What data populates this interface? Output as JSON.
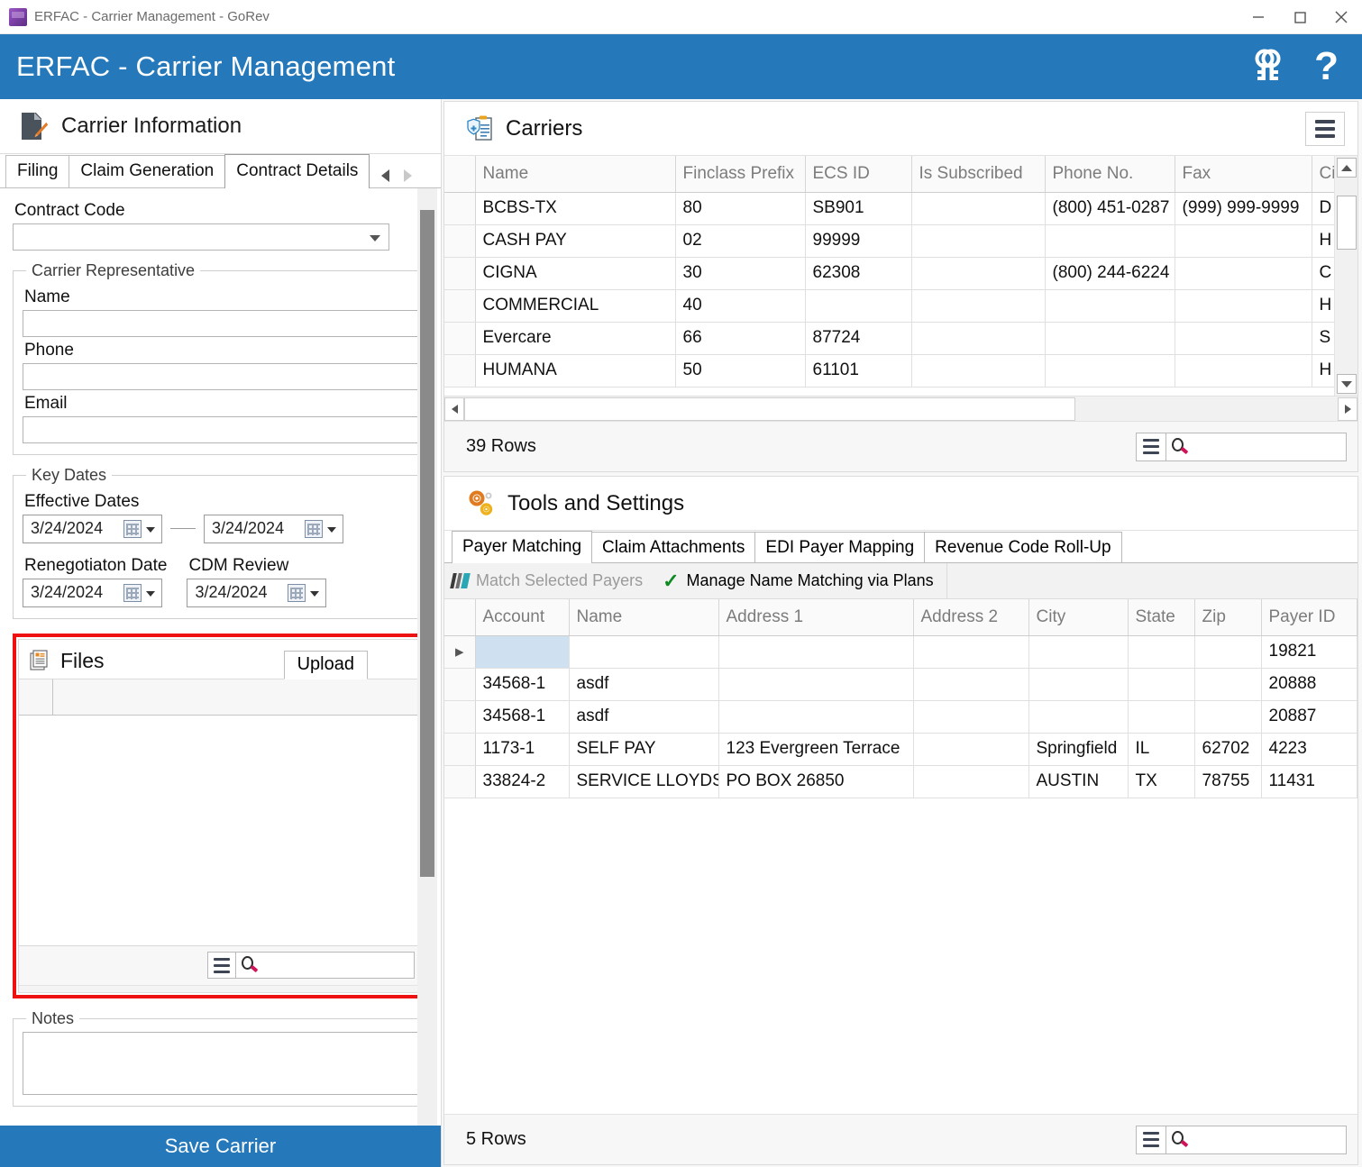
{
  "window": {
    "title": "ERFAC - Carrier Management - GoRev",
    "app_icon": "gorev-cube-icon",
    "minimize": "minimize-icon",
    "maximize": "maximize-icon",
    "close": "close-icon"
  },
  "header": {
    "title": "ERFAC - Carrier Management",
    "keys_icon": "keys-icon",
    "help_label": "?",
    "accent_color": "#2579ba"
  },
  "left_panel": {
    "heading": "Carrier Information",
    "heading_icon": "document-pen-icon",
    "tabs": [
      {
        "label": "Filing",
        "active": false
      },
      {
        "label": "Claim Generation",
        "active": false
      },
      {
        "label": "Contract Details",
        "active": true
      }
    ],
    "tab_nav": {
      "prev": "chevron-left-icon",
      "next": "chevron-right-icon"
    },
    "contract_code": {
      "label": "Contract Code",
      "value": "",
      "placeholder": ""
    },
    "carrier_representative": {
      "legend": "Carrier Representative",
      "fields": [
        {
          "label": "Name",
          "value": ""
        },
        {
          "label": "Phone",
          "value": ""
        },
        {
          "label": "Email",
          "value": ""
        }
      ]
    },
    "key_dates": {
      "legend": "Key Dates",
      "effective_label": "Effective Dates",
      "effective_from": "3/24/2024",
      "effective_to": "3/24/2024",
      "renegotiation_label": "Renegotiaton Date",
      "renegotiation_date": "3/24/2024",
      "cdm_label": "CDM Review",
      "cdm_date": "3/24/2024",
      "calendar_icon": "calendar-icon"
    },
    "files": {
      "title": "Files",
      "title_icon": "files-icon",
      "upload_label": "Upload",
      "highlight_color": "#ee1111",
      "rows": [],
      "hamburger_icon": "hamburger-icon",
      "search_icon": "search-icon",
      "search_value": ""
    },
    "notes": {
      "legend": "Notes",
      "value": ""
    },
    "save_button": "Save Carrier"
  },
  "carriers": {
    "title": "Carriers",
    "title_icon": "shield-clipboard-icon",
    "menu_icon": "hamburger-icon",
    "columns": [
      "Name",
      "Finclass Prefix",
      "ECS ID",
      "Is Subscribed",
      "Phone No.",
      "Fax",
      "City"
    ],
    "rows": [
      {
        "name": "BCBS-TX",
        "finclass_prefix": "80",
        "ecs_id": "SB901",
        "is_subscribed": "",
        "phone": "(800) 451-0287",
        "fax": "(999) 999-9999",
        "city": "D"
      },
      {
        "name": "CASH PAY",
        "finclass_prefix": "02",
        "ecs_id": "99999",
        "is_subscribed": "",
        "phone": "",
        "fax": "",
        "city": "H"
      },
      {
        "name": "CIGNA",
        "finclass_prefix": "30",
        "ecs_id": "62308",
        "is_subscribed": "",
        "phone": "(800) 244-6224",
        "fax": "",
        "city": "C"
      },
      {
        "name": "COMMERCIAL",
        "finclass_prefix": "40",
        "ecs_id": "",
        "is_subscribed": "",
        "phone": "",
        "fax": "",
        "city": "H"
      },
      {
        "name": "Evercare",
        "finclass_prefix": "66",
        "ecs_id": "87724",
        "is_subscribed": "",
        "phone": "",
        "fax": "",
        "city": "S"
      },
      {
        "name": "HUMANA",
        "finclass_prefix": "50",
        "ecs_id": "61101",
        "is_subscribed": "",
        "phone": "",
        "fax": "",
        "city": "H"
      }
    ],
    "row_count_label": "39 Rows",
    "hamburger_icon": "hamburger-icon",
    "search_icon": "search-icon",
    "search_value": ""
  },
  "tools": {
    "title": "Tools and Settings",
    "title_icon": "gears-icon",
    "tabs": [
      {
        "label": "Payer Matching",
        "active": true
      },
      {
        "label": "Claim Attachments",
        "active": false
      },
      {
        "label": "EDI Payer Mapping",
        "active": false
      },
      {
        "label": "Revenue Code Roll-Up",
        "active": false
      }
    ],
    "toolbar": [
      {
        "label": "Match Selected Payers",
        "icon": "stripes-icon",
        "disabled": true
      },
      {
        "label": "Manage Name Matching via Plans",
        "icon": "check-icon",
        "disabled": false
      }
    ],
    "grid": {
      "columns": [
        "Account",
        "Name",
        "Address 1",
        "Address 2",
        "City",
        "State",
        "Zip",
        "Payer ID"
      ],
      "rows": [
        {
          "selected": true,
          "account": "",
          "name": "",
          "address1": "",
          "address2": "",
          "city": "",
          "state": "",
          "zip": "",
          "payer_id": "19821"
        },
        {
          "selected": false,
          "account": "34568-1",
          "name": "asdf",
          "address1": "",
          "address2": "",
          "city": "",
          "state": "",
          "zip": "",
          "payer_id": "20888"
        },
        {
          "selected": false,
          "account": "34568-1",
          "name": "asdf",
          "address1": "",
          "address2": "",
          "city": "",
          "state": "",
          "zip": "",
          "payer_id": "20887"
        },
        {
          "selected": false,
          "account": "1173-1",
          "name": "SELF PAY",
          "address1": "123 Evergreen Terrace",
          "address2": "",
          "city": "Springfield",
          "state": "IL",
          "zip": "62702",
          "payer_id": "4223"
        },
        {
          "selected": false,
          "account": "33824-2",
          "name": "SERVICE LLOYDS",
          "address1": "PO BOX 26850",
          "address2": "",
          "city": "AUSTIN",
          "state": "TX",
          "zip": "78755",
          "payer_id": "11431"
        }
      ]
    },
    "row_count_label": "5 Rows",
    "hamburger_icon": "hamburger-icon",
    "search_icon": "search-icon",
    "search_value": ""
  }
}
